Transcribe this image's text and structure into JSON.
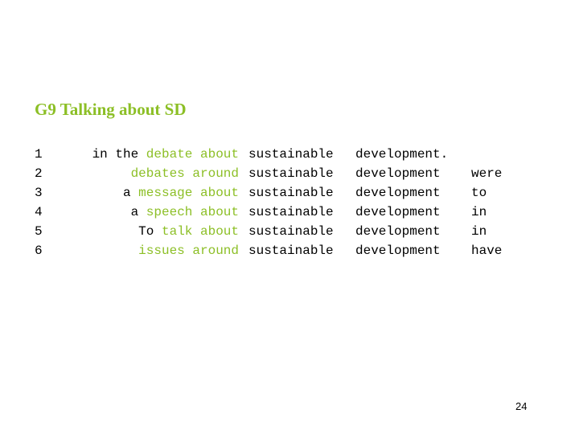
{
  "title": "G9 Talking about SD",
  "colors": {
    "highlight": "#8cbf26",
    "text": "#000000",
    "background": "#ffffff"
  },
  "concordance": [
    {
      "num": "1",
      "pre": "in the ",
      "hl": "debate",
      "post": " about",
      "kw1": "sustainable",
      "kw2": "development.",
      "right": ""
    },
    {
      "num": "2",
      "pre": "",
      "hl": "debates",
      "post": " around",
      "kw1": "sustainable",
      "kw2": "development",
      "right": "were"
    },
    {
      "num": "3",
      "pre": "a ",
      "hl": "message",
      "post": " about",
      "kw1": "sustainable",
      "kw2": "development",
      "right": "to"
    },
    {
      "num": "4",
      "pre": "a ",
      "hl": "speech",
      "post": " about",
      "kw1": "sustainable",
      "kw2": "development",
      "right": "in"
    },
    {
      "num": "5",
      "pre": "To ",
      "hl": "talk",
      "post": " about",
      "kw1": "sustainable",
      "kw2": "development",
      "right": "in"
    },
    {
      "num": "6",
      "pre": "",
      "hl": "issues",
      "post": " around",
      "kw1": "sustainable",
      "kw2": "development",
      "right": "have"
    }
  ],
  "page_number": "24"
}
